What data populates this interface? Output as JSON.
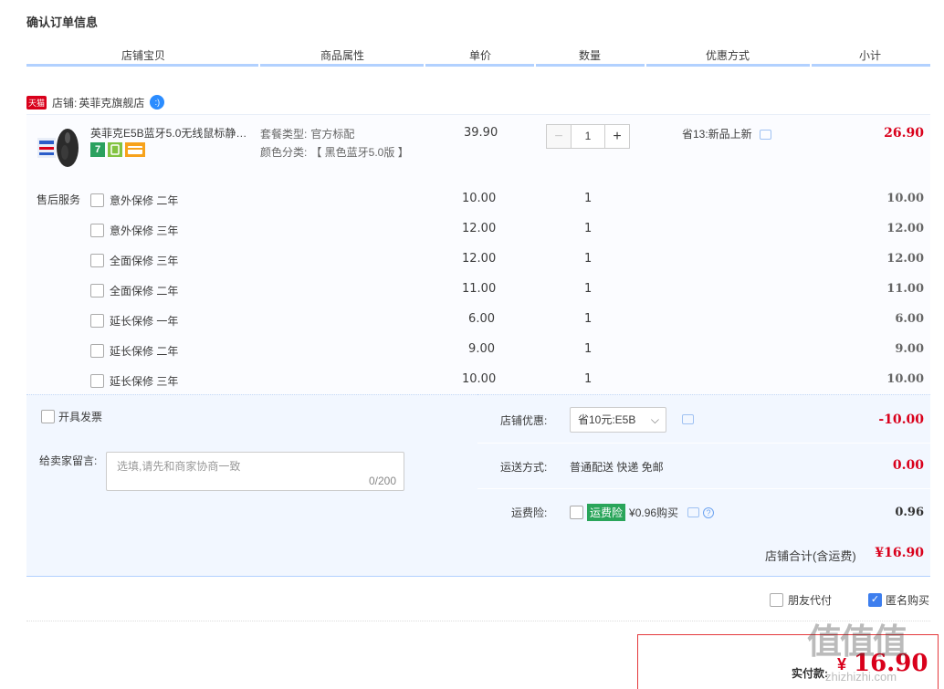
{
  "page_title": "确认订单信息",
  "columns": [
    "店铺宝贝",
    "商品属性",
    "单价",
    "数量",
    "优惠方式",
    "小计"
  ],
  "shop": {
    "tag": "天猫",
    "label": "店铺:",
    "name": "英菲克旗舰店",
    "wangwang_icon": "wangwang-chat-icon"
  },
  "item": {
    "name": "英菲克E5B蓝牙5.0无线鼠标静…",
    "attr1_label": "套餐类型:",
    "attr1_value": "官方标配",
    "attr2_label": "颜色分类:",
    "attr2_value": "【 黑色蓝牙5.0版 】",
    "price": "39.90",
    "qty": "1",
    "minus": "−",
    "plus": "+",
    "promo": "省13:新品上新",
    "subtotal": "26.90",
    "badge_7": "7"
  },
  "service_label": "售后服务",
  "services": [
    {
      "name": "意外保修 二年",
      "price": "10.00",
      "qty": "1",
      "subtotal": "10.00"
    },
    {
      "name": "意外保修 三年",
      "price": "12.00",
      "qty": "1",
      "subtotal": "12.00"
    },
    {
      "name": "全面保修 三年",
      "price": "12.00",
      "qty": "1",
      "subtotal": "12.00"
    },
    {
      "name": "全面保修 二年",
      "price": "11.00",
      "qty": "1",
      "subtotal": "11.00"
    },
    {
      "name": "延长保修 一年",
      "price": "6.00",
      "qty": "1",
      "subtotal": "6.00"
    },
    {
      "name": "延长保修 二年",
      "price": "9.00",
      "qty": "1",
      "subtotal": "9.00"
    },
    {
      "name": "延长保修 三年",
      "price": "10.00",
      "qty": "1",
      "subtotal": "10.00"
    }
  ],
  "invoice_label": "开具发票",
  "message": {
    "label": "给卖家留言:",
    "placeholder": "选填,请先和商家协商一致",
    "counter": "0/200"
  },
  "shop_discount": {
    "label": "店铺优惠:",
    "selected": "省10元:E5B",
    "amount": "-10.00"
  },
  "shipping": {
    "label": "运送方式:",
    "value": "普通配送 快递 免邮",
    "amount": "0.00"
  },
  "insurance": {
    "label": "运费险:",
    "tag": "运费险",
    "text": "¥0.96购买",
    "amount": "0.96",
    "help": "?"
  },
  "shop_total": {
    "label": "店铺合计(含运费)",
    "amount": "¥16.90"
  },
  "options": {
    "friend_pay": "朋友代付",
    "anonymous": "匿名购买"
  },
  "pay": {
    "label": "实付款:",
    "currency": "¥",
    "amount": "16.90"
  },
  "watermark": {
    "text": "值值值",
    "sub": "zhizhizhi.com"
  },
  "colors": {
    "accent": "#3d7eee",
    "price_red": "#d9001b",
    "header_line": "#b2d1ff"
  }
}
